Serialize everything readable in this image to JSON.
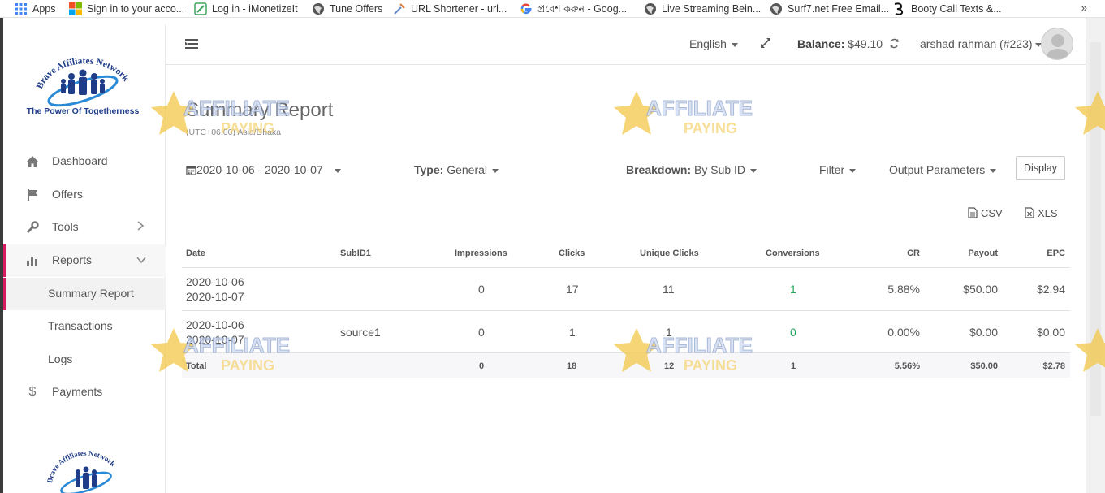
{
  "bookmarks": [
    {
      "label": "Apps",
      "icon": "apps-grid-icon"
    },
    {
      "label": "Sign in to your acco...",
      "icon": "microsoft-icon"
    },
    {
      "label": "Log in - iMonetizeIt",
      "icon": "pencil-doc-icon"
    },
    {
      "label": "Tune Offers",
      "icon": "globe-icon"
    },
    {
      "label": "URL Shortener - url...",
      "icon": "link-icon"
    },
    {
      "label": "প্রবেশ করুন - Goog...",
      "icon": "google-icon"
    },
    {
      "label": "Live Streaming Bein...",
      "icon": "globe-icon"
    },
    {
      "label": "Surf7.net Free Email...",
      "icon": "globe-icon"
    },
    {
      "label": "Booty Call Texts &...",
      "icon": "bc-logo-icon"
    }
  ],
  "bookmarks_more": "»",
  "logo": {
    "line1": "Brave Affiliates Network",
    "tagline": "The Power Of Togetherness"
  },
  "sidebar": {
    "items": [
      {
        "label": "Dashboard",
        "icon": "home-icon"
      },
      {
        "label": "Offers",
        "icon": "flag-icon"
      },
      {
        "label": "Tools",
        "icon": "wrench-icon"
      },
      {
        "label": "Reports",
        "icon": "bar-chart-icon"
      },
      {
        "label": "Payments",
        "icon": "dollar-icon"
      }
    ],
    "report_subitems": [
      "Summary Report",
      "Transactions",
      "Logs"
    ]
  },
  "header": {
    "language": "English",
    "balance_label": "Balance:",
    "balance_value": "$49.10",
    "user": "arshad rahman (#223)"
  },
  "page": {
    "title": "Summary Report",
    "timezone": "(UTC+06:00) Asia/Dhaka"
  },
  "filters": {
    "date_range": "2020-10-06 - 2020-10-07",
    "type_label": "Type:",
    "type_value": "General",
    "breakdown_label": "Breakdown:",
    "breakdown_value": "By Sub ID",
    "filter": "Filter",
    "output_parameters": "Output Parameters",
    "display_button": "Display"
  },
  "export": {
    "csv": "CSV",
    "xls": "XLS"
  },
  "table": {
    "headers": [
      "Date",
      "SubID1",
      "Impressions",
      "Clicks",
      "Unique Clicks",
      "Conversions",
      "CR",
      "Payout",
      "EPC"
    ],
    "rows": [
      {
        "date_from": "2020-10-06",
        "date_to": "2020-10-07",
        "subid": "",
        "impressions": "0",
        "clicks": "17",
        "unique_clicks": "11",
        "conversions": "1",
        "cr": "5.88%",
        "payout": "$50.00",
        "epc": "$2.94"
      },
      {
        "date_from": "2020-10-06",
        "date_to": "2020-10-07",
        "subid": "source1",
        "impressions": "0",
        "clicks": "1",
        "unique_clicks": "1",
        "conversions": "0",
        "cr": "0.00%",
        "payout": "$0.00",
        "epc": "$0.00"
      }
    ],
    "total": {
      "label": "Total",
      "impressions": "0",
      "clicks": "18",
      "unique_clicks": "12",
      "conversions": "1",
      "cr": "5.56%",
      "payout": "$50.00",
      "epc": "$2.78"
    }
  },
  "watermark": {
    "line1": "AFFILIATE",
    "line2": "PAYING"
  },
  "colors": {
    "accent": "#d81b60",
    "success": "#26a65b",
    "logo_blue": "#1f3c88"
  }
}
